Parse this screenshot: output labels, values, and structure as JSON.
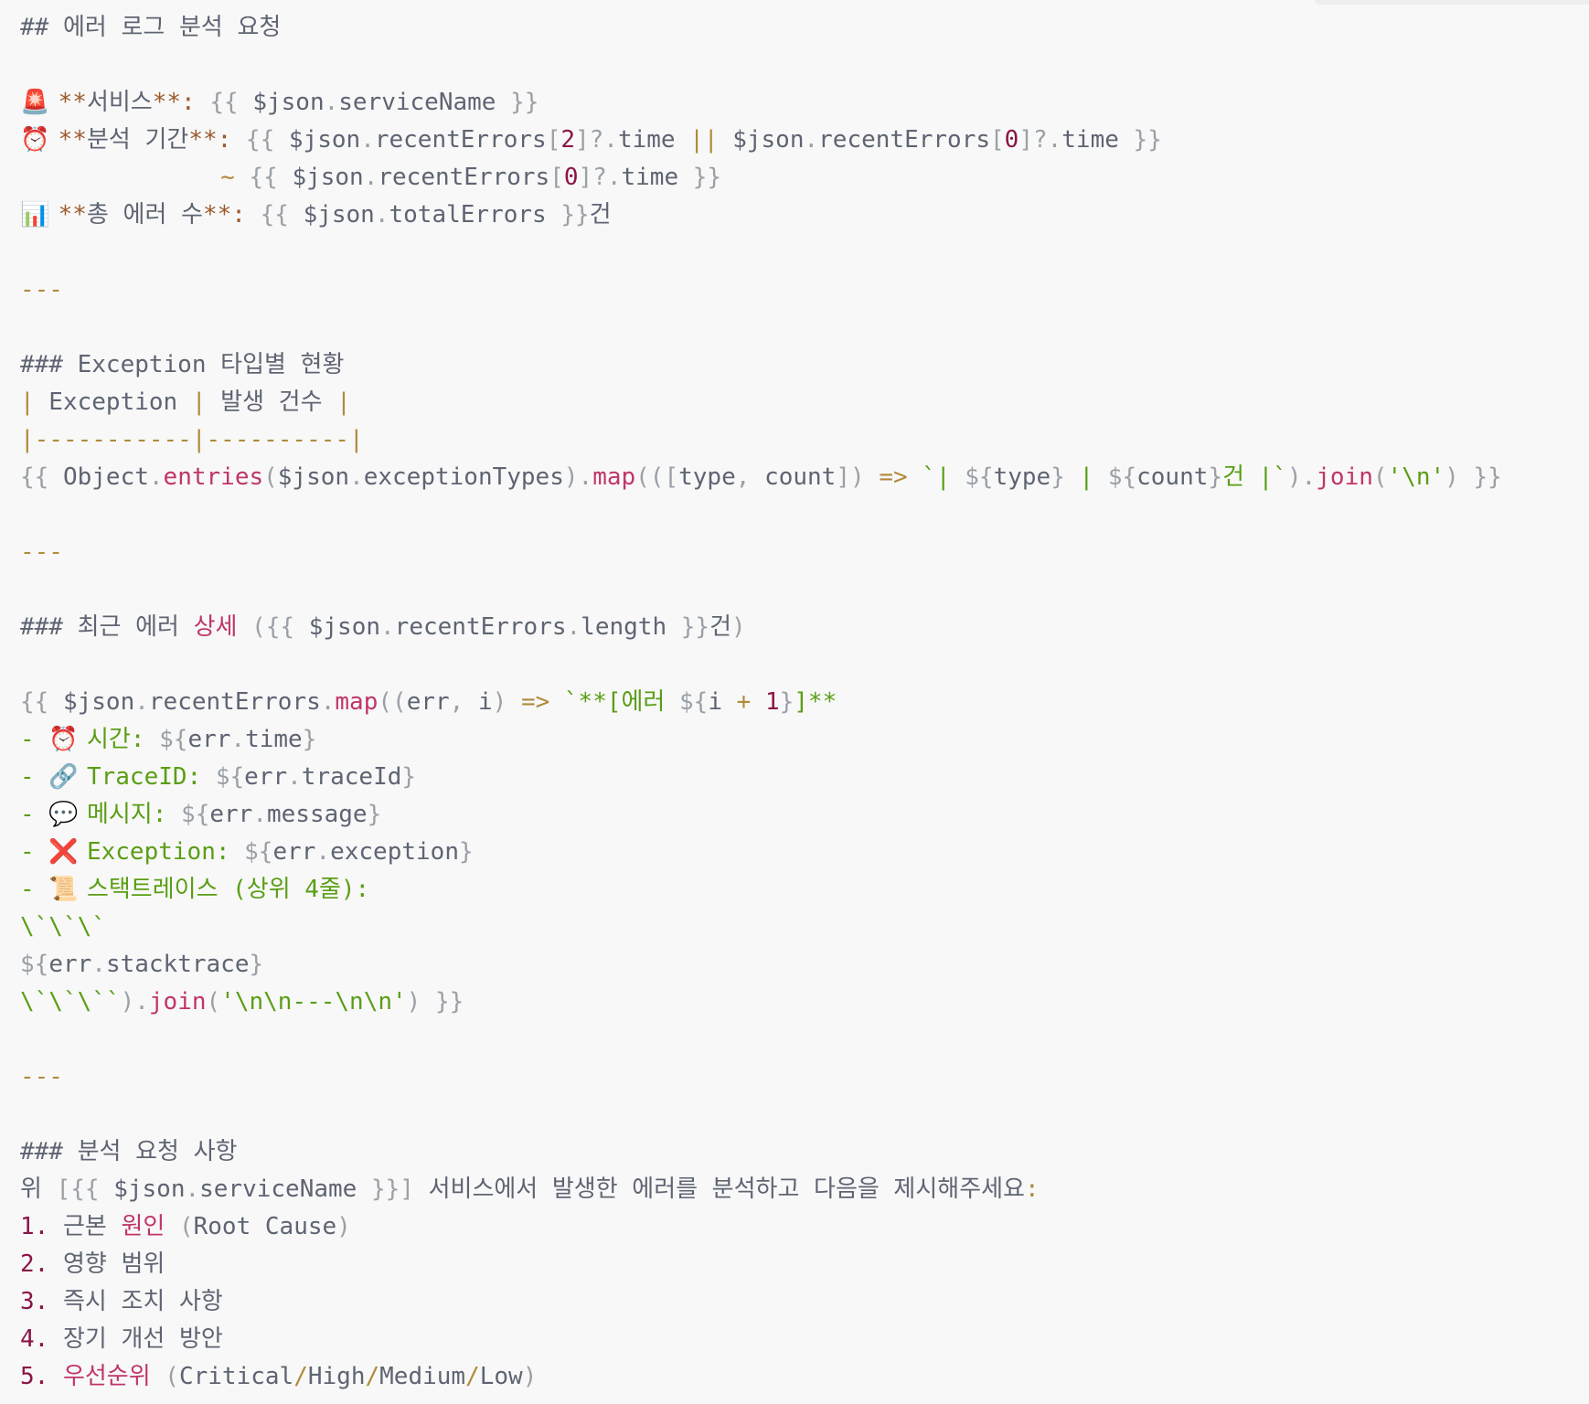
{
  "editor": {
    "lines": [
      [
        {
          "t": "## 에러 로그 분석 요청",
          "c": "c"
        }
      ],
      [],
      [
        {
          "t": "🚨",
          "c": "em",
          "icon": "siren-icon"
        },
        {
          "t": " ",
          "c": "c"
        },
        {
          "t": "**",
          "c": "s"
        },
        {
          "t": "서비스",
          "c": "c"
        },
        {
          "t": "**:",
          "c": "s"
        },
        {
          "t": " {{ ",
          "c": "p"
        },
        {
          "t": "$json",
          "c": "c"
        },
        {
          "t": ".",
          "c": "p"
        },
        {
          "t": "serviceName",
          "c": "c"
        },
        {
          "t": " }}",
          "c": "p"
        }
      ],
      [
        {
          "t": "⏰",
          "c": "em",
          "icon": "alarm-clock-icon"
        },
        {
          "t": " ",
          "c": "c"
        },
        {
          "t": "**",
          "c": "s"
        },
        {
          "t": "분석 기간",
          "c": "c"
        },
        {
          "t": "**:",
          "c": "s"
        },
        {
          "t": " {{ ",
          "c": "p"
        },
        {
          "t": "$json",
          "c": "c"
        },
        {
          "t": ".",
          "c": "p"
        },
        {
          "t": "recentErrors",
          "c": "c"
        },
        {
          "t": "[",
          "c": "p"
        },
        {
          "t": "2",
          "c": "n"
        },
        {
          "t": "]?.",
          "c": "p"
        },
        {
          "t": "time",
          "c": "c"
        },
        {
          "t": " || ",
          "c": "o"
        },
        {
          "t": "$json",
          "c": "c"
        },
        {
          "t": ".",
          "c": "p"
        },
        {
          "t": "recentErrors",
          "c": "c"
        },
        {
          "t": "[",
          "c": "p"
        },
        {
          "t": "0",
          "c": "n"
        },
        {
          "t": "]?.",
          "c": "p"
        },
        {
          "t": "time",
          "c": "c"
        },
        {
          "t": " }}",
          "c": "p"
        }
      ],
      [
        {
          "t": "              ",
          "c": "c"
        },
        {
          "t": "~",
          "c": "o"
        },
        {
          "t": " {{ ",
          "c": "p"
        },
        {
          "t": "$json",
          "c": "c"
        },
        {
          "t": ".",
          "c": "p"
        },
        {
          "t": "recentErrors",
          "c": "c"
        },
        {
          "t": "[",
          "c": "p"
        },
        {
          "t": "0",
          "c": "n"
        },
        {
          "t": "]?.",
          "c": "p"
        },
        {
          "t": "time",
          "c": "c"
        },
        {
          "t": " }}",
          "c": "p"
        }
      ],
      [
        {
          "t": "📊",
          "c": "em",
          "icon": "bar-chart-icon"
        },
        {
          "t": " ",
          "c": "c"
        },
        {
          "t": "**",
          "c": "s"
        },
        {
          "t": "총 에러 수",
          "c": "c"
        },
        {
          "t": "**:",
          "c": "s"
        },
        {
          "t": " {{ ",
          "c": "p"
        },
        {
          "t": "$json",
          "c": "c"
        },
        {
          "t": ".",
          "c": "p"
        },
        {
          "t": "totalErrors",
          "c": "c"
        },
        {
          "t": " }}",
          "c": "p"
        },
        {
          "t": "건",
          "c": "c"
        }
      ],
      [],
      [
        {
          "t": "---",
          "c": "o"
        }
      ],
      [],
      [
        {
          "t": "### Exception 타입별 현황",
          "c": "c"
        }
      ],
      [
        {
          "t": "|",
          "c": "o"
        },
        {
          "t": " Exception ",
          "c": "c"
        },
        {
          "t": "|",
          "c": "o"
        },
        {
          "t": " 발생 건수 ",
          "c": "c"
        },
        {
          "t": "|",
          "c": "o"
        }
      ],
      [
        {
          "t": "|-----------|----------|",
          "c": "o"
        }
      ],
      [
        {
          "t": "{{ ",
          "c": "p"
        },
        {
          "t": "Object",
          "c": "c"
        },
        {
          "t": ".",
          "c": "p"
        },
        {
          "t": "entries",
          "c": "m"
        },
        {
          "t": "(",
          "c": "p"
        },
        {
          "t": "$json",
          "c": "c"
        },
        {
          "t": ".",
          "c": "p"
        },
        {
          "t": "exceptionTypes",
          "c": "c"
        },
        {
          "t": ").",
          "c": "p"
        },
        {
          "t": "map",
          "c": "m"
        },
        {
          "t": "(([",
          "c": "p"
        },
        {
          "t": "type",
          "c": "c"
        },
        {
          "t": ", ",
          "c": "p"
        },
        {
          "t": "count",
          "c": "c"
        },
        {
          "t": "]) ",
          "c": "p"
        },
        {
          "t": "=>",
          "c": "o"
        },
        {
          "t": " `| ",
          "c": "g"
        },
        {
          "t": "${",
          "c": "p"
        },
        {
          "t": "type",
          "c": "c"
        },
        {
          "t": "}",
          "c": "p"
        },
        {
          "t": " | ",
          "c": "g"
        },
        {
          "t": "${",
          "c": "p"
        },
        {
          "t": "count",
          "c": "c"
        },
        {
          "t": "}",
          "c": "p"
        },
        {
          "t": "건 |`",
          "c": "g"
        },
        {
          "t": ").",
          "c": "p"
        },
        {
          "t": "join",
          "c": "m"
        },
        {
          "t": "(",
          "c": "p"
        },
        {
          "t": "'\\n'",
          "c": "g"
        },
        {
          "t": ") }}",
          "c": "p"
        }
      ],
      [],
      [
        {
          "t": "---",
          "c": "o"
        }
      ],
      [],
      [
        {
          "t": "### 최근 에러 ",
          "c": "c"
        },
        {
          "t": "상세",
          "c": "m"
        },
        {
          "t": " ({{ ",
          "c": "p"
        },
        {
          "t": "$json",
          "c": "c"
        },
        {
          "t": ".",
          "c": "p"
        },
        {
          "t": "recentErrors",
          "c": "c"
        },
        {
          "t": ".",
          "c": "p"
        },
        {
          "t": "length",
          "c": "c"
        },
        {
          "t": " }}",
          "c": "p"
        },
        {
          "t": "건",
          "c": "c"
        },
        {
          "t": ")",
          "c": "p"
        }
      ],
      [],
      [
        {
          "t": "{{ ",
          "c": "p"
        },
        {
          "t": "$json",
          "c": "c"
        },
        {
          "t": ".",
          "c": "p"
        },
        {
          "t": "recentErrors",
          "c": "c"
        },
        {
          "t": ".",
          "c": "p"
        },
        {
          "t": "map",
          "c": "m"
        },
        {
          "t": "((",
          "c": "p"
        },
        {
          "t": "err",
          "c": "c"
        },
        {
          "t": ", ",
          "c": "p"
        },
        {
          "t": "i",
          "c": "c"
        },
        {
          "t": ") ",
          "c": "p"
        },
        {
          "t": "=>",
          "c": "o"
        },
        {
          "t": " `**[에러 ",
          "c": "g"
        },
        {
          "t": "${",
          "c": "p"
        },
        {
          "t": "i",
          "c": "c"
        },
        {
          "t": " + ",
          "c": "o"
        },
        {
          "t": "1",
          "c": "n"
        },
        {
          "t": "}",
          "c": "p"
        },
        {
          "t": "]**",
          "c": "g"
        }
      ],
      [
        {
          "t": "- ",
          "c": "g"
        },
        {
          "t": "⏰",
          "c": "em",
          "icon": "alarm-clock-icon"
        },
        {
          "t": " 시간: ",
          "c": "g"
        },
        {
          "t": "${",
          "c": "p"
        },
        {
          "t": "err",
          "c": "c"
        },
        {
          "t": ".",
          "c": "p"
        },
        {
          "t": "time",
          "c": "c"
        },
        {
          "t": "}",
          "c": "p"
        }
      ],
      [
        {
          "t": "- ",
          "c": "g"
        },
        {
          "t": "🔗",
          "c": "em",
          "icon": "link-icon"
        },
        {
          "t": " TraceID: ",
          "c": "g"
        },
        {
          "t": "${",
          "c": "p"
        },
        {
          "t": "err",
          "c": "c"
        },
        {
          "t": ".",
          "c": "p"
        },
        {
          "t": "traceId",
          "c": "c"
        },
        {
          "t": "}",
          "c": "p"
        }
      ],
      [
        {
          "t": "- ",
          "c": "g"
        },
        {
          "t": "💬",
          "c": "em",
          "icon": "speech-bubble-icon"
        },
        {
          "t": " 메시지: ",
          "c": "g"
        },
        {
          "t": "${",
          "c": "p"
        },
        {
          "t": "err",
          "c": "c"
        },
        {
          "t": ".",
          "c": "p"
        },
        {
          "t": "message",
          "c": "c"
        },
        {
          "t": "}",
          "c": "p"
        }
      ],
      [
        {
          "t": "- ",
          "c": "g"
        },
        {
          "t": "❌",
          "c": "em",
          "icon": "cross-mark-icon"
        },
        {
          "t": " Exception: ",
          "c": "g"
        },
        {
          "t": "${",
          "c": "p"
        },
        {
          "t": "err",
          "c": "c"
        },
        {
          "t": ".",
          "c": "p"
        },
        {
          "t": "exception",
          "c": "c"
        },
        {
          "t": "}",
          "c": "p"
        }
      ],
      [
        {
          "t": "- ",
          "c": "g"
        },
        {
          "t": "📜",
          "c": "em",
          "icon": "scroll-icon"
        },
        {
          "t": " 스택트레이스 (상위 4줄):",
          "c": "g"
        }
      ],
      [
        {
          "t": "\\`\\`\\`",
          "c": "g"
        }
      ],
      [
        {
          "t": "${",
          "c": "p"
        },
        {
          "t": "err",
          "c": "c"
        },
        {
          "t": ".",
          "c": "p"
        },
        {
          "t": "stacktrace",
          "c": "c"
        },
        {
          "t": "}",
          "c": "p"
        }
      ],
      [
        {
          "t": "\\`\\`\\``",
          "c": "g"
        },
        {
          "t": ").",
          "c": "p"
        },
        {
          "t": "join",
          "c": "m"
        },
        {
          "t": "(",
          "c": "p"
        },
        {
          "t": "'\\n\\n---\\n\\n'",
          "c": "g"
        },
        {
          "t": ") }}",
          "c": "p"
        }
      ],
      [],
      [
        {
          "t": "---",
          "c": "o"
        }
      ],
      [],
      [
        {
          "t": "### 분석 요청 사항",
          "c": "c"
        }
      ],
      [
        {
          "t": "위 ",
          "c": "c"
        },
        {
          "t": "[{{ ",
          "c": "p"
        },
        {
          "t": "$json",
          "c": "c"
        },
        {
          "t": ".",
          "c": "p"
        },
        {
          "t": "serviceName",
          "c": "c"
        },
        {
          "t": " }}]",
          "c": "p"
        },
        {
          "t": " 서비스에서 발생한 에러를 분석하고 다음을 제시해주세요",
          "c": "c"
        },
        {
          "t": ":",
          "c": "o"
        }
      ],
      [
        {
          "t": "1.",
          "c": "n"
        },
        {
          "t": " 근본 ",
          "c": "c"
        },
        {
          "t": "원인",
          "c": "m"
        },
        {
          "t": " (",
          "c": "p"
        },
        {
          "t": "Root Cause",
          "c": "c"
        },
        {
          "t": ")",
          "c": "p"
        }
      ],
      [
        {
          "t": "2.",
          "c": "n"
        },
        {
          "t": " 영향 범위",
          "c": "c"
        }
      ],
      [
        {
          "t": "3.",
          "c": "n"
        },
        {
          "t": " 즉시 조치 사항",
          "c": "c"
        }
      ],
      [
        {
          "t": "4.",
          "c": "n"
        },
        {
          "t": " 장기 개선 방안",
          "c": "c"
        }
      ],
      [
        {
          "t": "5.",
          "c": "n"
        },
        {
          "t": " ",
          "c": "c"
        },
        {
          "t": "우선순위",
          "c": "m"
        },
        {
          "t": " (",
          "c": "p"
        },
        {
          "t": "Critical",
          "c": "c"
        },
        {
          "t": "/",
          "c": "o"
        },
        {
          "t": "High",
          "c": "c"
        },
        {
          "t": "/",
          "c": "o"
        },
        {
          "t": "Medium",
          "c": "c"
        },
        {
          "t": "/",
          "c": "o"
        },
        {
          "t": "Low",
          "c": "c"
        },
        {
          "t": ")",
          "c": "p"
        }
      ]
    ]
  }
}
